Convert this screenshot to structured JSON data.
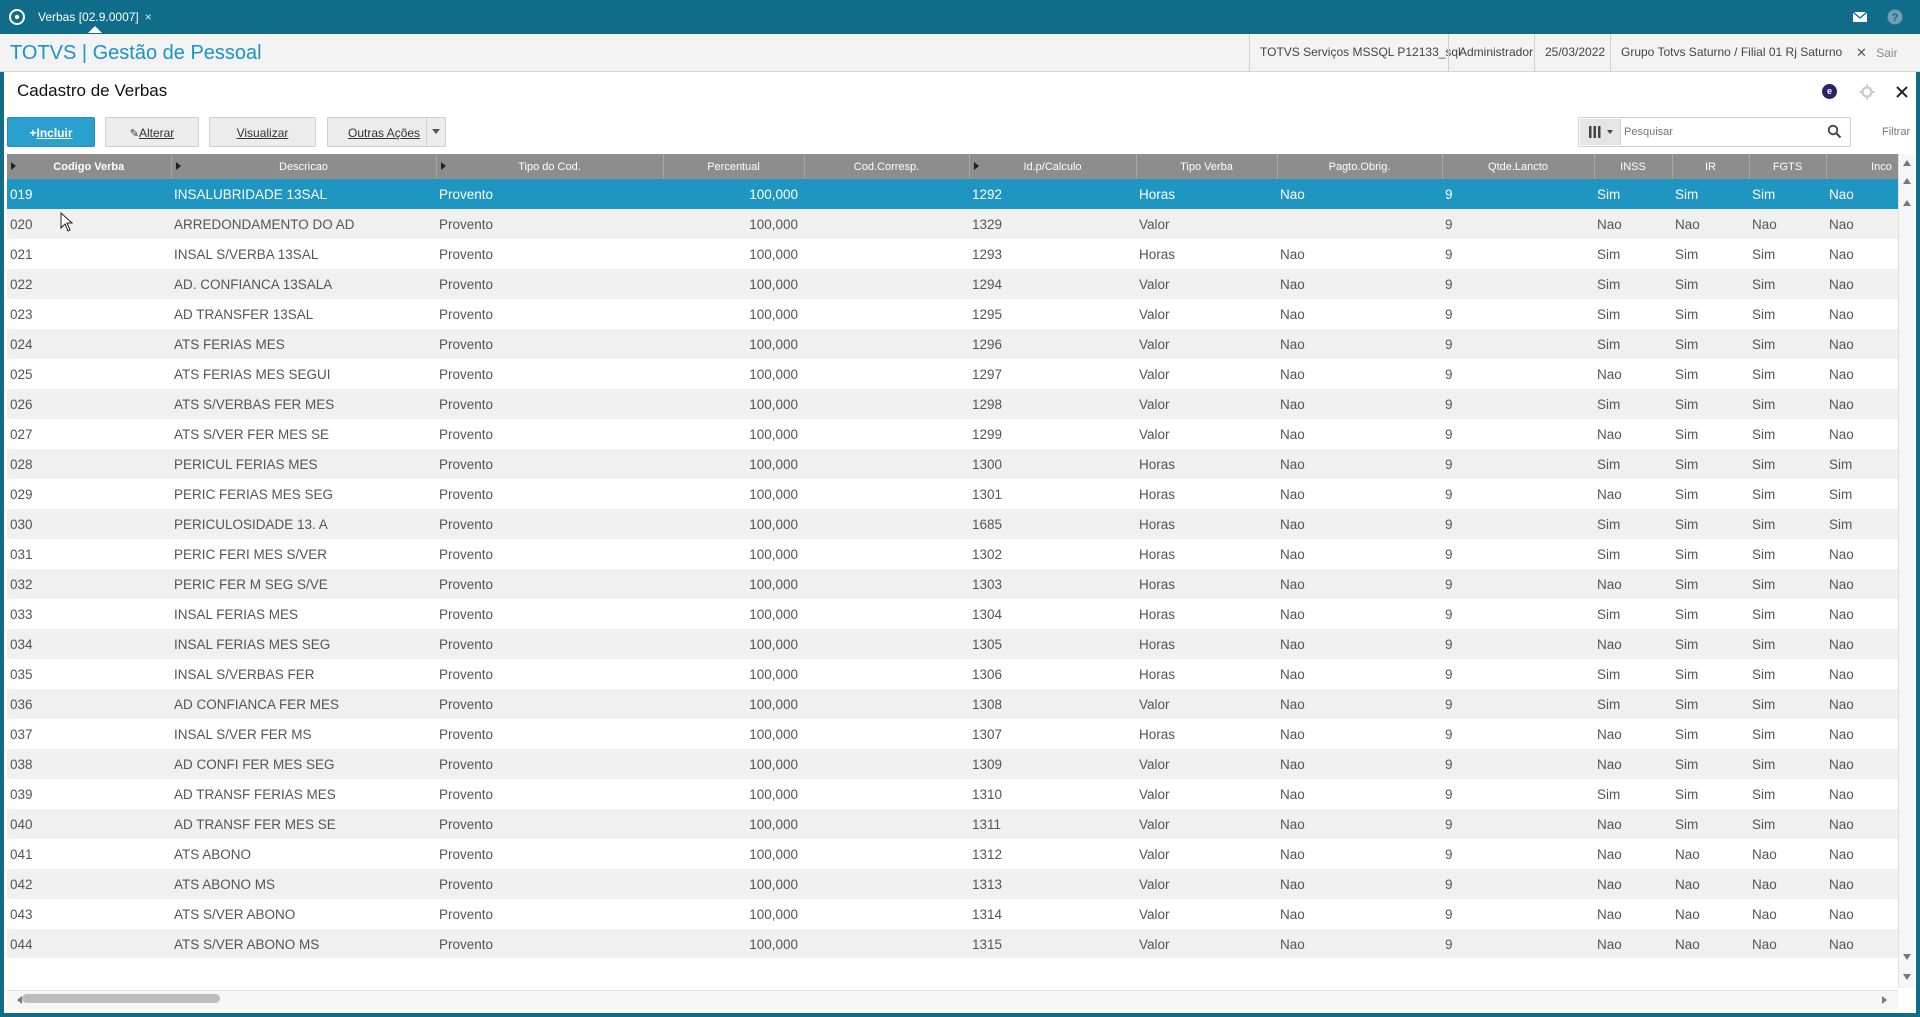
{
  "tab": {
    "label": "Verbas [02.9.0007]",
    "close": "×"
  },
  "header": {
    "brand": "TOTVS | Gestão de Pessoal",
    "environment": "TOTVS Serviços MSSQL P12133_sql",
    "user": "Administrador",
    "date": "25/03/2022",
    "company": "Grupo Totvs Saturno / Filial 01 Rj Saturno",
    "logout": "Sair"
  },
  "page": {
    "title": "Cadastro de Verbas",
    "badge": "e"
  },
  "toolbar": {
    "incluir": "Incluir",
    "alterar": "Alterar",
    "visualizar": "Visualizar",
    "outras": "Outras Ações",
    "search_placeholder": "Pesquisar",
    "filtrar": "Filtrar"
  },
  "colors": {
    "accent": "#1f95c2",
    "topbar": "#0f6d8a",
    "header_grid": "#8d8d8d"
  },
  "grid": {
    "columns": [
      "Codigo Verba",
      "Descricao",
      "Tipo do Cod.",
      "Percentual",
      "Cod.Corresp.",
      "Id.p/Calculo",
      "Tipo Verba",
      "Pagto.Obrig.",
      "Qtde.Lancto",
      "INSS",
      "IR",
      "FGTS",
      "Inco"
    ],
    "selected_row": 0,
    "rows": [
      [
        "019",
        "INSALUBRIDADE 13SAL",
        "Provento",
        "100,000",
        "",
        "1292",
        "Horas",
        "Nao",
        "9",
        "Sim",
        "Sim",
        "Sim",
        "Nao"
      ],
      [
        "020",
        "ARREDONDAMENTO DO AD",
        "Provento",
        "100,000",
        "",
        "1329",
        "Valor",
        "",
        "9",
        "Nao",
        "Nao",
        "Nao",
        "Nao"
      ],
      [
        "021",
        "INSAL S/VERBA 13SAL",
        "Provento",
        "100,000",
        "",
        "1293",
        "Horas",
        "Nao",
        "9",
        "Sim",
        "Sim",
        "Sim",
        "Nao"
      ],
      [
        "022",
        "AD. CONFIANCA 13SALA",
        "Provento",
        "100,000",
        "",
        "1294",
        "Valor",
        "Nao",
        "9",
        "Sim",
        "Sim",
        "Sim",
        "Nao"
      ],
      [
        "023",
        "AD TRANSFER 13SAL",
        "Provento",
        "100,000",
        "",
        "1295",
        "Valor",
        "Nao",
        "9",
        "Sim",
        "Sim",
        "Sim",
        "Nao"
      ],
      [
        "024",
        "ATS FERIAS MES",
        "Provento",
        "100,000",
        "",
        "1296",
        "Valor",
        "Nao",
        "9",
        "Sim",
        "Sim",
        "Sim",
        "Nao"
      ],
      [
        "025",
        "ATS FERIAS MES SEGUI",
        "Provento",
        "100,000",
        "",
        "1297",
        "Valor",
        "Nao",
        "9",
        "Nao",
        "Sim",
        "Sim",
        "Nao"
      ],
      [
        "026",
        "ATS S/VERBAS FER MES",
        "Provento",
        "100,000",
        "",
        "1298",
        "Valor",
        "Nao",
        "9",
        "Sim",
        "Sim",
        "Sim",
        "Nao"
      ],
      [
        "027",
        "ATS S/VER FER MES SE",
        "Provento",
        "100,000",
        "",
        "1299",
        "Valor",
        "Nao",
        "9",
        "Nao",
        "Sim",
        "Sim",
        "Nao"
      ],
      [
        "028",
        "PERICUL FERIAS MES",
        "Provento",
        "100,000",
        "",
        "1300",
        "Horas",
        "Nao",
        "9",
        "Sim",
        "Sim",
        "Sim",
        "Sim"
      ],
      [
        "029",
        "PERIC FERIAS MES SEG",
        "Provento",
        "100,000",
        "",
        "1301",
        "Horas",
        "Nao",
        "9",
        "Nao",
        "Sim",
        "Sim",
        "Sim"
      ],
      [
        "030",
        "PERICULOSIDADE 13. A",
        "Provento",
        "100,000",
        "",
        "1685",
        "Horas",
        "Nao",
        "9",
        "Sim",
        "Sim",
        "Sim",
        "Sim"
      ],
      [
        "031",
        "PERIC FERI MES S/VER",
        "Provento",
        "100,000",
        "",
        "1302",
        "Horas",
        "Nao",
        "9",
        "Sim",
        "Sim",
        "Sim",
        "Nao"
      ],
      [
        "032",
        "PERIC FER M SEG S/VE",
        "Provento",
        "100,000",
        "",
        "1303",
        "Horas",
        "Nao",
        "9",
        "Nao",
        "Sim",
        "Sim",
        "Nao"
      ],
      [
        "033",
        "INSAL FERIAS MES",
        "Provento",
        "100,000",
        "",
        "1304",
        "Horas",
        "Nao",
        "9",
        "Sim",
        "Sim",
        "Sim",
        "Nao"
      ],
      [
        "034",
        "INSAL FERIAS MES SEG",
        "Provento",
        "100,000",
        "",
        "1305",
        "Horas",
        "Nao",
        "9",
        "Nao",
        "Sim",
        "Sim",
        "Nao"
      ],
      [
        "035",
        "INSAL S/VERBAS FER",
        "Provento",
        "100,000",
        "",
        "1306",
        "Horas",
        "Nao",
        "9",
        "Sim",
        "Sim",
        "Sim",
        "Nao"
      ],
      [
        "036",
        "AD CONFIANCA FER MES",
        "Provento",
        "100,000",
        "",
        "1308",
        "Valor",
        "Nao",
        "9",
        "Sim",
        "Sim",
        "Sim",
        "Nao"
      ],
      [
        "037",
        "INSAL S/VER FER MS",
        "Provento",
        "100,000",
        "",
        "1307",
        "Horas",
        "Nao",
        "9",
        "Nao",
        "Sim",
        "Sim",
        "Nao"
      ],
      [
        "038",
        "AD CONFI FER MES SEG",
        "Provento",
        "100,000",
        "",
        "1309",
        "Valor",
        "Nao",
        "9",
        "Nao",
        "Sim",
        "Sim",
        "Nao"
      ],
      [
        "039",
        "AD TRANSF FERIAS MES",
        "Provento",
        "100,000",
        "",
        "1310",
        "Valor",
        "Nao",
        "9",
        "Sim",
        "Sim",
        "Sim",
        "Nao"
      ],
      [
        "040",
        "AD TRANSF FER MES SE",
        "Provento",
        "100,000",
        "",
        "1311",
        "Valor",
        "Nao",
        "9",
        "Nao",
        "Sim",
        "Sim",
        "Nao"
      ],
      [
        "041",
        "ATS ABONO",
        "Provento",
        "100,000",
        "",
        "1312",
        "Valor",
        "Nao",
        "9",
        "Nao",
        "Nao",
        "Nao",
        "Nao"
      ],
      [
        "042",
        "ATS ABONO MS",
        "Provento",
        "100,000",
        "",
        "1313",
        "Valor",
        "Nao",
        "9",
        "Nao",
        "Nao",
        "Nao",
        "Nao"
      ],
      [
        "043",
        "ATS S/VER ABONO",
        "Provento",
        "100,000",
        "",
        "1314",
        "Valor",
        "Nao",
        "9",
        "Nao",
        "Nao",
        "Nao",
        "Nao"
      ],
      [
        "044",
        "ATS S/VER ABONO MS",
        "Provento",
        "100,000",
        "",
        "1315",
        "Valor",
        "Nao",
        "9",
        "Nao",
        "Nao",
        "Nao",
        "Nao"
      ]
    ]
  }
}
